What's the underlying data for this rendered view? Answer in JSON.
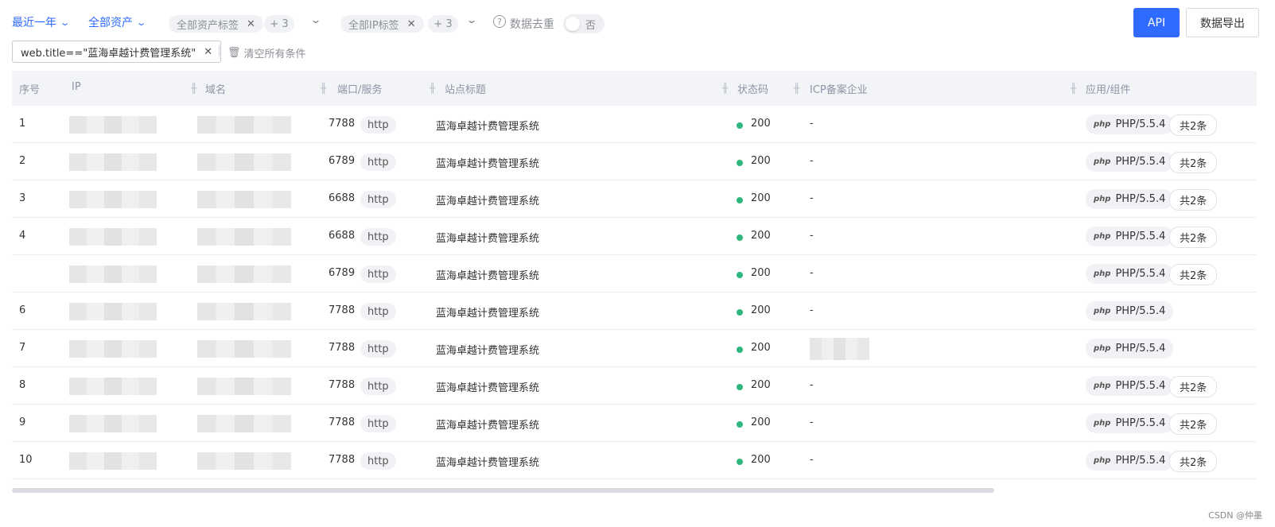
{
  "filters": {
    "time_range": "最近一年",
    "asset_scope": "全部资产",
    "asset_tag": "全部资产标签",
    "asset_tag_more": "+ 3",
    "ip_tag": "全部IP标签",
    "ip_tag_more": "+ 3",
    "dedupe_label": "数据去重",
    "dedupe_value": "否"
  },
  "actions": {
    "api": "API",
    "export": "数据导出"
  },
  "condition": {
    "query": "web.title==\"蓝海卓越计费管理系统\"",
    "clear_all": "清空所有条件"
  },
  "table": {
    "columns": [
      "序号",
      "IP",
      "域名",
      "端口/服务",
      "站点标题",
      "状态码",
      "ICP备案企业",
      "应用/组件"
    ],
    "rows": [
      {
        "no": "1",
        "port": "7788",
        "service": "http",
        "title": "蓝海卓越计费管理系统",
        "status": "200",
        "icp": "-",
        "app": "PHP/5.5.4",
        "more": "共2条"
      },
      {
        "no": "2",
        "port": "6789",
        "service": "http",
        "title": "蓝海卓越计费管理系统",
        "status": "200",
        "icp": "-",
        "app": "PHP/5.5.4",
        "more": "共2条"
      },
      {
        "no": "3",
        "port": "6688",
        "service": "http",
        "title": "蓝海卓越计费管理系统",
        "status": "200",
        "icp": "-",
        "app": "PHP/5.5.4",
        "more": "共2条"
      },
      {
        "no": "4",
        "port": "6688",
        "service": "http",
        "title": "蓝海卓越计费管理系统",
        "status": "200",
        "icp": "-",
        "app": "PHP/5.5.4",
        "more": "共2条"
      },
      {
        "no": "",
        "port": "6789",
        "service": "http",
        "title": "蓝海卓越计费管理系统",
        "status": "200",
        "icp": "-",
        "app": "PHP/5.5.4",
        "more": "共2条"
      },
      {
        "no": "6",
        "port": "7788",
        "service": "http",
        "title": "蓝海卓越计费管理系统",
        "status": "200",
        "icp": "-",
        "app": "PHP/5.5.4",
        "more": ""
      },
      {
        "no": "7",
        "port": "7788",
        "service": "http",
        "title": "蓝海卓越计费管理系统",
        "status": "200",
        "icp": "",
        "app": "PHP/5.5.4",
        "more": ""
      },
      {
        "no": "8",
        "port": "7788",
        "service": "http",
        "title": "蓝海卓越计费管理系统",
        "status": "200",
        "icp": "-",
        "app": "PHP/5.5.4",
        "more": "共2条"
      },
      {
        "no": "9",
        "port": "7788",
        "service": "http",
        "title": "蓝海卓越计费管理系统",
        "status": "200",
        "icp": "-",
        "app": "PHP/5.5.4",
        "more": "共2条"
      },
      {
        "no": "10",
        "port": "7788",
        "service": "http",
        "title": "蓝海卓越计费管理系统",
        "status": "200",
        "icp": "-",
        "app": "PHP/5.5.4",
        "more": "共2条"
      }
    ]
  },
  "app_logo": "php",
  "status_color": "#2eb67d",
  "accent_color": "#2f6bff",
  "watermark": "CSDN @仲墨"
}
